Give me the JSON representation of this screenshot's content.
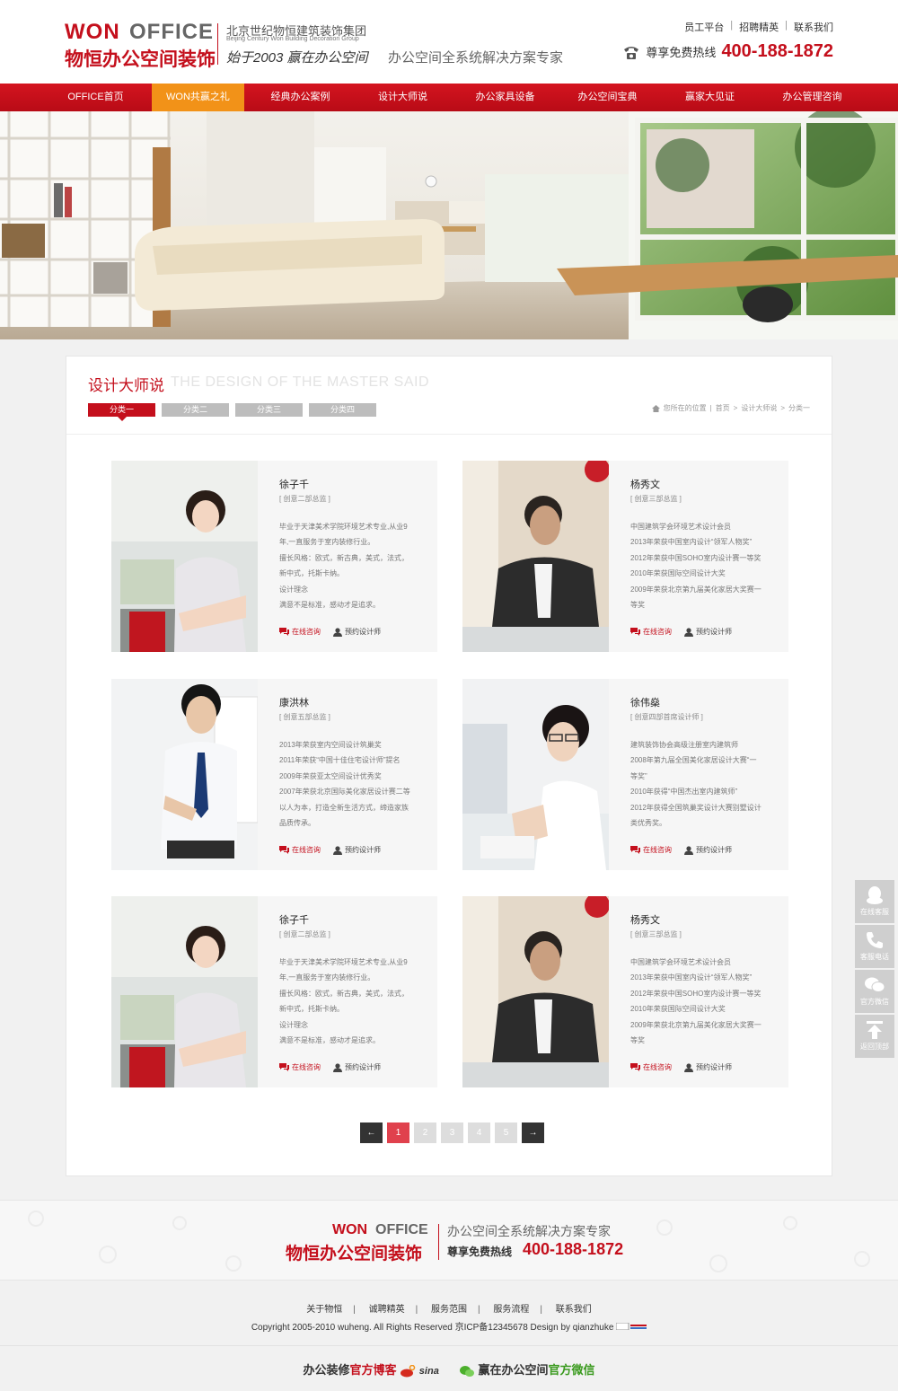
{
  "header": {
    "logo_won": "WON",
    "logo_office": "OFFICE",
    "logo_cn": "物恒办公空间装饰",
    "group_cn": "北京世纪物恒建筑装饰集团",
    "group_en": "Beijing Century Won Building Decoration Group",
    "slogan1": "始于2003  赢在办公空间",
    "slogan2": "办公空间全系统解决方案专家",
    "top_links": [
      "员工平台",
      "招聘精英",
      "联系我们"
    ],
    "hotline_label": "尊享免费热线",
    "hotline_number": "400-188-1872"
  },
  "nav": {
    "items": [
      "OFFICE首页",
      "WON共赢之礼",
      "经典办公案例",
      "设计大师说",
      "办公家具设备",
      "办公空间宝典",
      "赢家大见证",
      "办公管理咨询"
    ],
    "active_index": 1
  },
  "section": {
    "title": "设计大师说",
    "title_en": "THE DESIGN OF THE MASTER SAID",
    "tabs": [
      "分类一",
      "分类二",
      "分类三",
      "分类四"
    ],
    "active_tab": 0,
    "breadcrumb": [
      "您所在的位置",
      "首页",
      "设计大师说",
      "分类一"
    ]
  },
  "designers": [
    {
      "name": "徐子千",
      "role": "[ 创意二部总监 ]",
      "lines": [
        "毕业于天津美术学院环境艺术专业,从业9",
        "年,一直服务于室内装修行业。",
        "擅长风格：欧式，新古典，美式，法式，",
        "新中式，托斯卡纳。",
        "设计理念",
        "满意不是标准，感动才是追求。"
      ],
      "consult": "在线咨询",
      "book": "预约设计师"
    },
    {
      "name": "杨秀文",
      "role": "[ 创意三部总监 ]",
      "lines": [
        "中国建筑学会环境艺术设计会员",
        "2013年荣获中国室内设计“领军人物奖”",
        "2012年荣获中国SOHO室内设计赛一等奖",
        "2010年荣获国际空间设计大奖",
        "2009年荣获北京第九届美化家居大奖赛一",
        "等奖"
      ],
      "consult": "在线咨询",
      "book": "预约设计师"
    },
    {
      "name": "康洪林",
      "role": "[ 创意五部总监 ]",
      "lines": [
        "2013年荣获室内空间设计筑巢奖",
        "2011年荣获“中国十佳住宅设计师”提名",
        "2009年荣获亚太空间设计优秀奖",
        "2007年荣获北京国际美化家居设计赛二等",
        "以人为本，打造全新生活方式，缔造家族",
        "品质传承。"
      ],
      "consult": "在线咨询",
      "book": "预约设计师"
    },
    {
      "name": "徐伟燊",
      "role": "[ 创意四部首席设计师 ]",
      "lines": [
        "建筑装饰协会高级注册室内建筑师",
        "2008年第九届全国美化家居设计大赛“一",
        "等奖”",
        "2010年获得“中国杰出室内建筑师”",
        "2012年获得全国筑巢奖设计大赛别墅设计",
        "类优秀奖。"
      ],
      "consult": "在线咨询",
      "book": "预约设计师"
    },
    {
      "name": "徐子千",
      "role": "[ 创意二部总监 ]",
      "lines": [
        "毕业于天津美术学院环境艺术专业,从业9",
        "年,一直服务于室内装修行业。",
        "擅长风格：欧式，新古典，美式，法式，",
        "新中式，托斯卡纳。",
        "设计理念",
        "满意不是标准，感动才是追求。"
      ],
      "consult": "在线咨询",
      "book": "预约设计师"
    },
    {
      "name": "杨秀文",
      "role": "[ 创意三部总监 ]",
      "lines": [
        "中国建筑学会环境艺术设计会员",
        "2013年荣获中国室内设计“领军人物奖”",
        "2012年荣获中国SOHO室内设计赛一等奖",
        "2010年荣获国际空间设计大奖",
        "2009年荣获北京第九届美化家居大奖赛一",
        "等奖"
      ],
      "consult": "在线咨询",
      "book": "预约设计师"
    }
  ],
  "pager": {
    "prev": "←",
    "pages": [
      "1",
      "2",
      "3",
      "4",
      "5"
    ],
    "current": 1,
    "next": "→"
  },
  "side_tools": [
    "在线客服",
    "客服电话",
    "官方微信",
    "返回顶部"
  ],
  "footer": {
    "logo_won": "WON",
    "logo_office": "OFFICE",
    "logo_cn": "物恒办公空间装饰",
    "slogan": "办公空间全系统解决方案专家",
    "hotline_label": "尊享免费热线",
    "hotline_number": "400-188-1872",
    "links": [
      "关于物恒",
      "诚聘精英",
      "服务范围",
      "服务流程",
      "联系我们"
    ],
    "copyright": "Copyright 2005-2010 wuheng. All Rights Reserved 京ICP备12345678  Design by qianzhuke",
    "weibo_prefix": "办公装修",
    "weibo_highlight": "官方博客",
    "weibo_brand": "sina",
    "wechat_prefix": "赢在办公空间",
    "wechat_highlight": "官方微信"
  },
  "colors": {
    "brand_red": "#c40f1c",
    "nav_active": "#f29218",
    "pager_current": "#e0414d"
  }
}
